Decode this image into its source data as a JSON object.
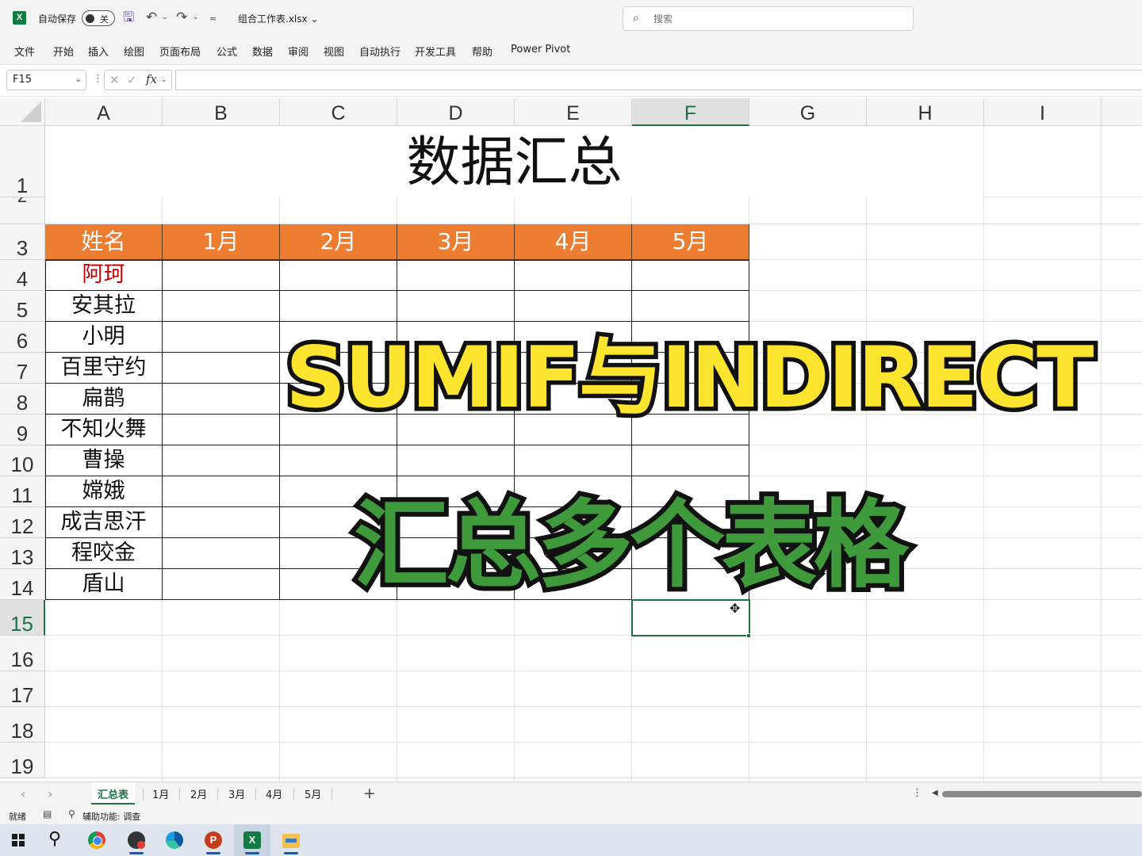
{
  "titlebar": {
    "app_logo": "X",
    "autosave_label": "自动保存",
    "autosave_state": "关",
    "file_name": "组合工作表.xlsx",
    "file_caret": "⌄",
    "search_placeholder": "搜索",
    "icons": [
      "excel-logo-icon",
      "save-icon",
      "undo-icon",
      "redo-icon",
      "qat-more-icon",
      "search-icon"
    ]
  },
  "ribbon": {
    "tabs": [
      "文件",
      "开始",
      "插入",
      "绘图",
      "页面布局",
      "公式",
      "数据",
      "审阅",
      "视图",
      "自动执行",
      "开发工具",
      "帮助",
      "Power Pivot"
    ]
  },
  "formula_bar": {
    "name_box": "F15",
    "fx": "fx",
    "value": ""
  },
  "grid": {
    "columns": [
      "A",
      "B",
      "C",
      "D",
      "E",
      "F",
      "G",
      "H",
      "I"
    ],
    "active_column": "F",
    "rows": [
      "1",
      "2",
      "3",
      "4",
      "5",
      "6",
      "7",
      "8",
      "9",
      "10",
      "11",
      "12",
      "13",
      "14",
      "15",
      "16",
      "17",
      "18",
      "19"
    ],
    "active_row": "15",
    "active_cell": "F15"
  },
  "sheet": {
    "title": "数据汇总",
    "header_label": "姓名",
    "months": [
      "1月",
      "2月",
      "3月",
      "4月",
      "5月"
    ],
    "names": [
      "阿珂",
      "安其拉",
      "小明",
      "百里守约",
      "扁鹊",
      "不知火舞",
      "曹操",
      "嫦娥",
      "成吉思汗",
      "程咬金",
      "盾山"
    ],
    "colors": {
      "header_fill": "#ed7d31",
      "header_text": "#ffffff",
      "first_name_text": "#c00000",
      "accent": "#217346"
    }
  },
  "overlay": {
    "line1": "SUMIF与INDIRECT",
    "line2": "汇总多个表格",
    "colors": {
      "line1": "#fde42e",
      "line2": "#3f9a3c",
      "outline": "#111111"
    }
  },
  "sheet_tabs": {
    "tabs": [
      "汇总表",
      "1月",
      "2月",
      "3月",
      "4月",
      "5月"
    ],
    "active": "汇总表",
    "add_label": "+"
  },
  "status_bar": {
    "ready": "就绪",
    "accessibility": "辅助功能: 调查"
  },
  "taskbar": {
    "items": [
      "start-icon",
      "search-icon",
      "chrome-icon",
      "capture-icon",
      "edge-icon",
      "powerpoint-icon",
      "excel-icon",
      "file-explorer-icon"
    ],
    "ppt_letter": "P",
    "excel_letter": "X"
  }
}
